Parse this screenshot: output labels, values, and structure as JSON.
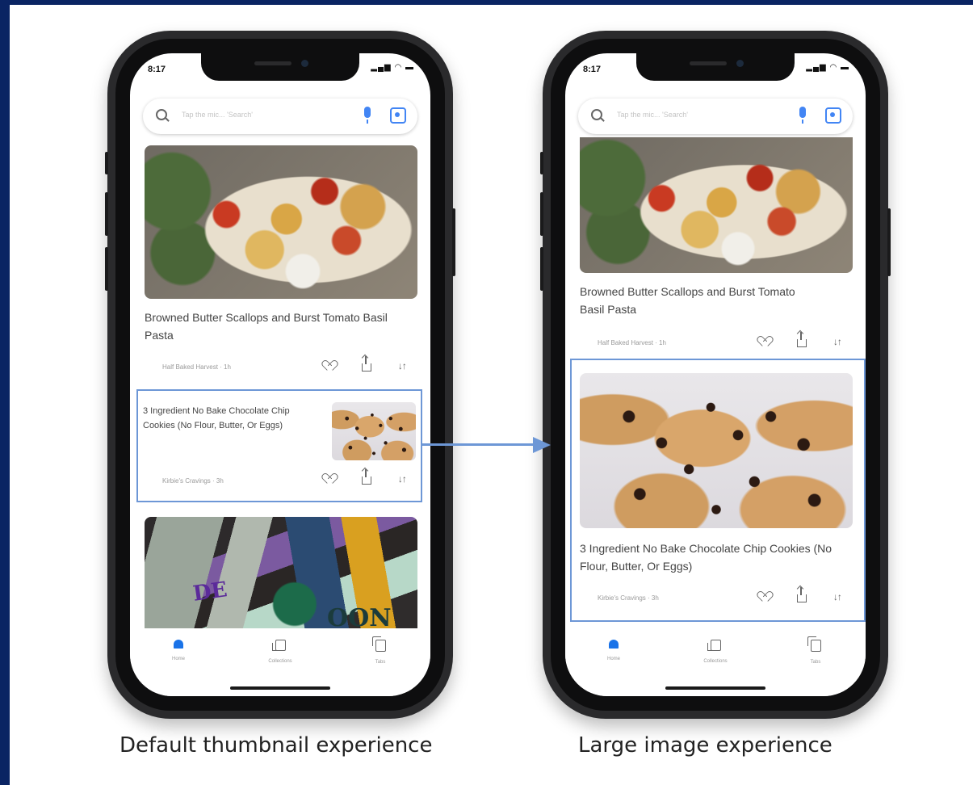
{
  "status_bar": {
    "time": "8:17",
    "icons": "▂▄▆ ◠ ▬"
  },
  "search": {
    "placeholder": "Tap the mic... 'Search'"
  },
  "feed": {
    "pasta": {
      "title": "Browned Butter Scallops and Burst Tomato Basil Pasta",
      "source": "Half Baked Harvest · 1h"
    },
    "cookie": {
      "title": "3 Ingredient No Bake Chocolate Chip Cookies (No Flour, Butter, Or Eggs)",
      "source": "Kirbie's Cravings · 3h"
    },
    "cards": {
      "art_text_1": "DE",
      "art_text_2": "OON"
    }
  },
  "actions": {
    "sort_glyph": "↓↑"
  },
  "bottom_nav": [
    {
      "label": "Home"
    },
    {
      "label": "Collections"
    },
    {
      "label": "Tabs"
    }
  ],
  "captions": {
    "left": "Default thumbnail experience",
    "right": "Large image experience"
  },
  "colors": {
    "accent": "#1a73e8",
    "highlight": "#6d97d6",
    "frame_border": "#0a2463"
  }
}
